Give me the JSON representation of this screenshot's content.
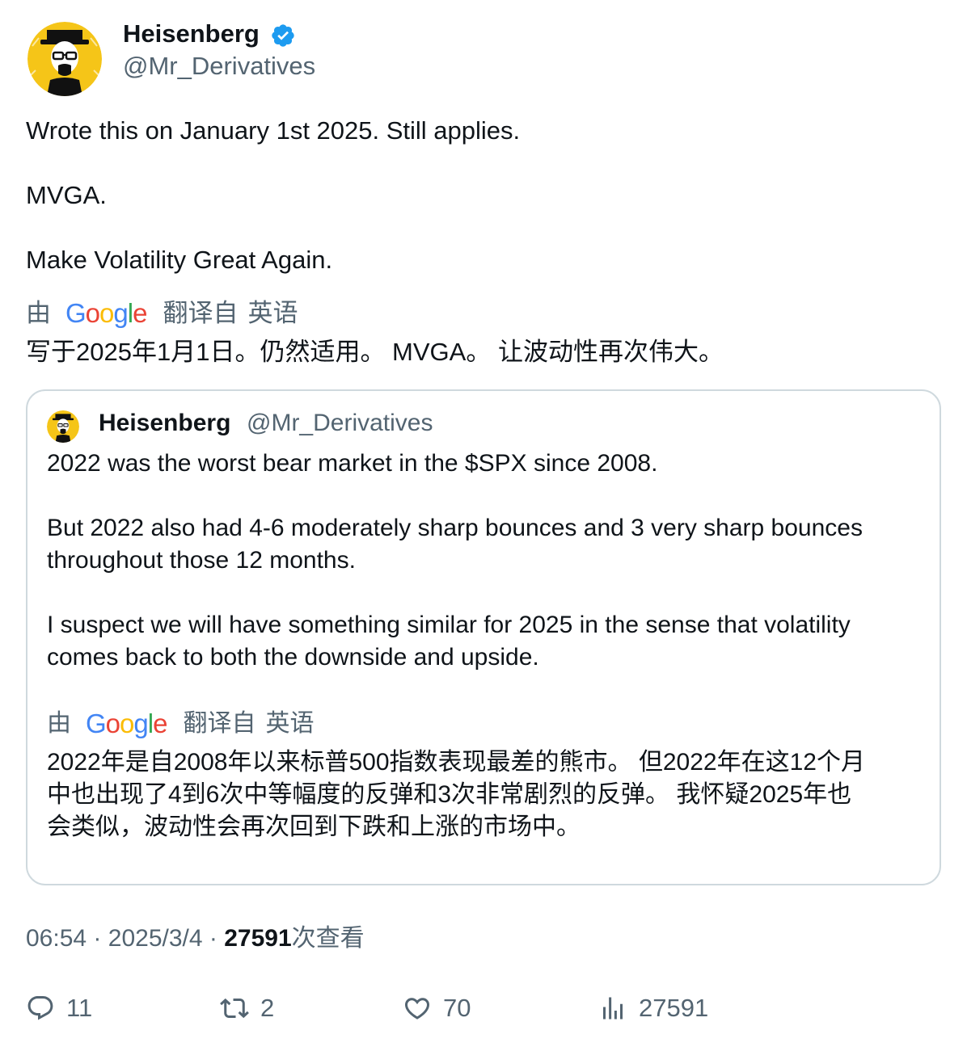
{
  "author": {
    "name": "Heisenberg",
    "handle": "@Mr_Derivatives",
    "verified": true
  },
  "tweet": {
    "lines": [
      "Wrote this on January 1st 2025. Still applies.",
      "MVGA.",
      "Make Volatility Great Again."
    ],
    "translation": {
      "prefix": "由",
      "provider": "Google",
      "suffix": "翻译自",
      "language": "英语",
      "text": "写于2025年1月1日。仍然适用。 MVGA。 让波动性再次伟大。"
    }
  },
  "quoted_tweet": {
    "name": "Heisenberg",
    "handle": "@Mr_Derivatives",
    "lines": [
      "2022 was the worst bear market in the $SPX since 2008.",
      "But 2022 also had 4-6 moderately sharp bounces and 3 very sharp bounces",
      "throughout those 12 months.",
      "I suspect we will have something similar for 2025 in the sense that volatility",
      "comes back to both the downside and upside."
    ],
    "translation": {
      "prefix": "由",
      "provider": "Google",
      "suffix": "翻译自",
      "language": "英语",
      "lines": [
        "2022年是自2008年以来标普500指数表现最差的熊市。 但2022年在这12个月",
        "中也出现了4到6次中等幅度的反弹和3次非常剧烈的反弹。 我怀疑2025年也",
        "会类似，波动性会再次回到下跌和上涨的市场中。"
      ]
    }
  },
  "meta": {
    "time": "06:54",
    "separator": "·",
    "date": "2025/3/4",
    "views": "27591",
    "views_label": "次查看"
  },
  "actions": {
    "replies": "11",
    "reposts": "2",
    "likes": "70",
    "views": "27591"
  },
  "colors": {
    "verified": "#1d9bf0",
    "text": "#0f1419",
    "secondary": "#536471",
    "border": "#cfd9de",
    "avatar_bg": "#f5c518"
  },
  "icons": [
    "verified-badge-icon",
    "reply-icon",
    "repost-icon",
    "like-icon",
    "views-icon"
  ]
}
